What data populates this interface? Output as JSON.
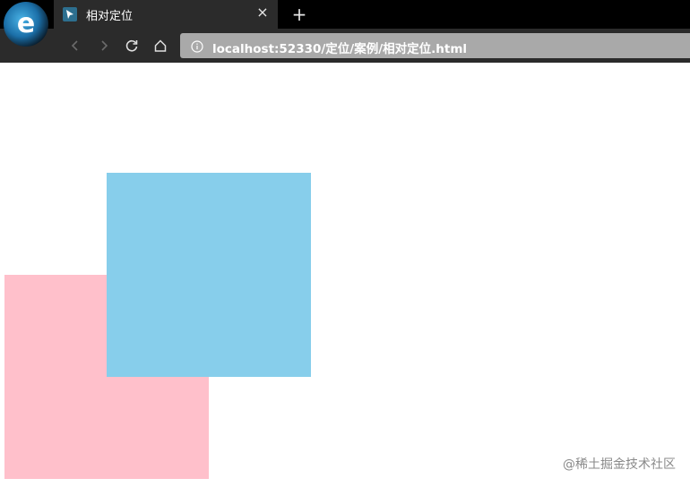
{
  "browser": {
    "tab": {
      "title": "相对定位",
      "close_glyph": "×"
    },
    "new_tab_glyph": "+",
    "address_bar": {
      "url": "localhost:52330/定位/案例/相对定位.html"
    },
    "icons": {
      "logo": "browser-logo-icon",
      "favicon": "page-favicon-icon",
      "back": "back-arrow-icon",
      "forward": "forward-arrow-icon",
      "reload": "reload-icon",
      "home": "home-icon",
      "info": "info-icon"
    }
  },
  "page": {
    "boxes": [
      {
        "name": "pink-box",
        "color": "#ffc0cb"
      },
      {
        "name": "blue-box",
        "color": "#87ceeb"
      }
    ],
    "watermark": "@稀土掘金技术社区"
  }
}
